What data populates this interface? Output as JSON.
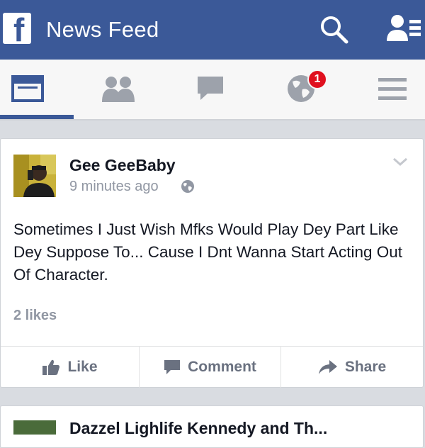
{
  "header": {
    "title": "News Feed",
    "brand_color": "#3b5998",
    "icons": [
      "facebook-logo",
      "search-icon",
      "friends-icon"
    ]
  },
  "nav": {
    "tabs": [
      {
        "name": "news-feed",
        "icon": "feed-icon",
        "active": true
      },
      {
        "name": "friend-requests",
        "icon": "friend-requests-icon"
      },
      {
        "name": "messages",
        "icon": "messages-icon"
      },
      {
        "name": "notifications",
        "icon": "globe-icon",
        "badge": "1"
      },
      {
        "name": "more",
        "icon": "menu-icon"
      }
    ],
    "badge_color": "#e0101f"
  },
  "post": {
    "author": "Gee GeeBaby",
    "timestamp": "9 minutes ago",
    "text": "Sometimes I Just Wish Mfks Would Play Dey Part Like Dey Suppose To... Cause I Dnt Wanna Start Acting Out Of Character.",
    "likes": "2 likes",
    "actions": {
      "like": "Like",
      "comment": "Comment",
      "share": "Share"
    }
  },
  "next_post": {
    "author": "Dazzel Lighlife Kennedy and Th..."
  }
}
